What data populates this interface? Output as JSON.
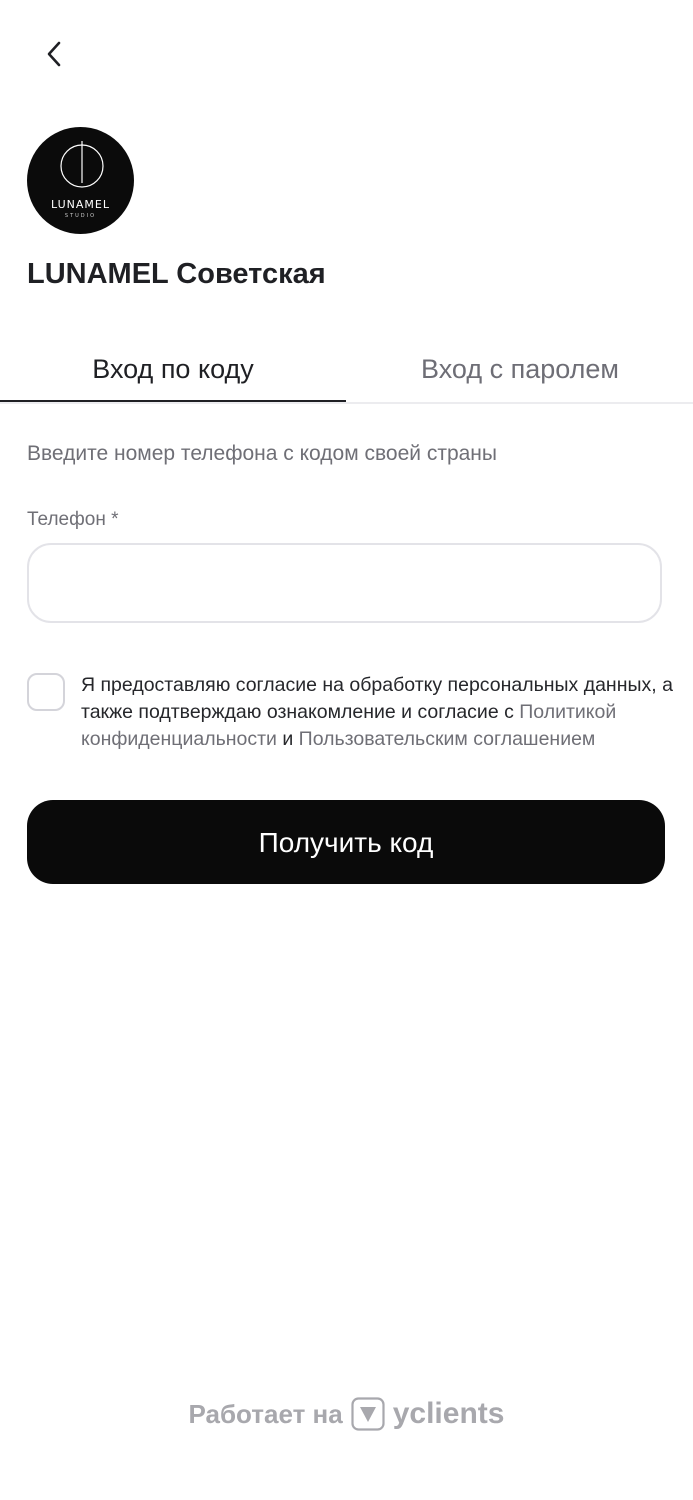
{
  "logo": {
    "name": "LUNAMEL",
    "sub": "STUDIO"
  },
  "salon": {
    "title": "LUNAMEL Советская"
  },
  "tabs": [
    {
      "label": "Вход по коду",
      "active": true
    },
    {
      "label": "Вход с паролем",
      "active": false
    }
  ],
  "form": {
    "hint": "Введите номер телефона с кодом своей страны",
    "phone_label": "Телефон *",
    "phone_value": "",
    "phone_placeholder": "",
    "consent_text_1": "Я предоставляю согласие на обработку персональных данных, а также подтверждаю ознакомление и согласие с ",
    "consent_link_privacy": "Политикой конфиденциальности",
    "consent_and": " и ",
    "consent_link_terms": "Пользовательским соглашением",
    "consent_checked": false,
    "submit_label": "Получить код"
  },
  "footer": {
    "powered_by": "Работает на",
    "brand": "yclients"
  },
  "colors": {
    "primary_button": "#0a0a0a",
    "accent_text": "#1f2024",
    "muted_text": "#6f6f76"
  },
  "icons": {
    "back": "chevron-left-icon",
    "brand": "yclients-logo-icon"
  }
}
